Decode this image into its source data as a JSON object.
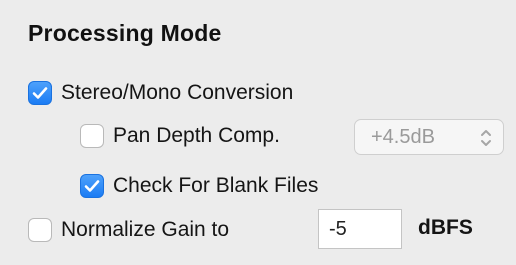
{
  "section": {
    "title": "Processing Mode"
  },
  "options": {
    "stereo_mono": {
      "label": "Stereo/Mono Conversion",
      "checked": true
    },
    "pan_depth": {
      "label": "Pan Depth Comp.",
      "checked": false
    },
    "blank_files": {
      "label": "Check For Blank Files",
      "checked": true
    },
    "normalize": {
      "label": "Normalize Gain to",
      "checked": false
    }
  },
  "pan_depth_select": {
    "value": "+4.5dB",
    "enabled": false
  },
  "normalize_input": {
    "value": "-5",
    "unit": "dBFS"
  },
  "colors": {
    "accent": "#1b7cf4",
    "background": "#ececec"
  }
}
